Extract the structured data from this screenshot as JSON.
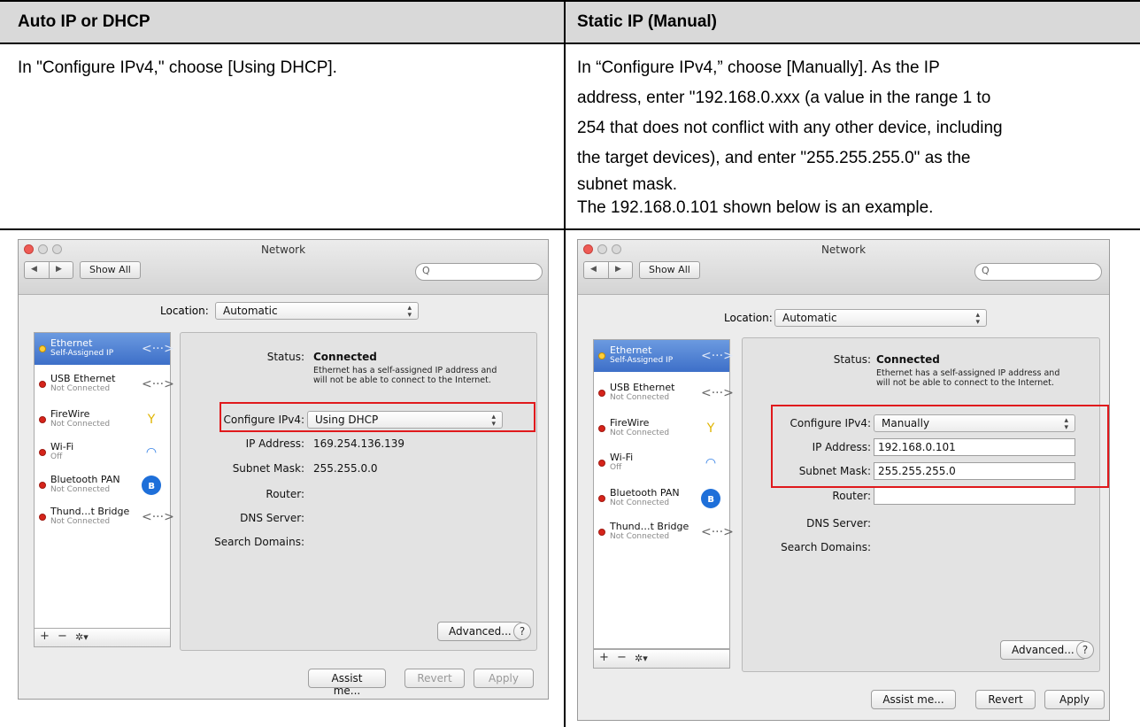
{
  "table": {
    "col1_header": "Auto IP or DHCP",
    "col2_header": "Static IP (Manual)",
    "col1_text": "In \"Configure IPv4,\" choose [Using DHCP].",
    "col2_lines": [
      "In “Configure IPv4,” choose [Manually]. As the IP",
      "address, enter \"192.168.0.xxx (a value in the range 1 to",
      "254 that does not conflict with any other device, including",
      "the target devices), and enter \"255.255.255.0\" as the",
      "subnet mask.",
      "The 192.168.0.101 shown below is an example."
    ]
  },
  "common": {
    "window_title": "Network",
    "show_all": "Show All",
    "back_icon": "◀",
    "fwd_icon": "▶",
    "search_icon": "Q",
    "location_label": "Location:",
    "location_value": "Automatic",
    "status_label": "Status:",
    "status_value": "Connected",
    "status_note_1": "Ethernet has a self-assigned IP address and",
    "status_note_2": "will not be able to connect to the Internet.",
    "configure_label": "Configure IPv4:",
    "ip_label": "IP Address:",
    "subnet_label": "Subnet Mask:",
    "router_label": "Router:",
    "dns_label": "DNS Server:",
    "search_domains_label": "Search Domains:",
    "advanced": "Advanced...",
    "help": "?",
    "assist": "Assist me...",
    "revert": "Revert",
    "apply": "Apply",
    "tool_add": "+",
    "tool_remove": "−",
    "tool_gear": "✲▾",
    "services": [
      {
        "name": "Ethernet",
        "status": "Self-Assigned IP",
        "icon": "ethernet-icon",
        "glyph": "<···>"
      },
      {
        "name": "USB Ethernet",
        "status": "Not Connected",
        "icon": "ethernet-icon",
        "glyph": "<···>"
      },
      {
        "name": "FireWire",
        "status": "Not Connected",
        "icon": "firewire-icon",
        "glyph": "Y"
      },
      {
        "name": "Wi-Fi",
        "status": "Off",
        "icon": "wifi-icon",
        "glyph": "◠"
      },
      {
        "name": "Bluetooth PAN",
        "status": "Not Connected",
        "icon": "bluetooth-icon",
        "glyph": "ʙ"
      },
      {
        "name": "Thund…t Bridge",
        "status": "Not Connected",
        "icon": "ethernet-icon",
        "glyph": "<···>"
      }
    ]
  },
  "dhcp": {
    "configure_value": "Using DHCP",
    "ip_value": "169.254.136.139",
    "subnet_value": "255.255.0.0"
  },
  "manual": {
    "configure_value": "Manually",
    "ip_value": "192.168.0.101",
    "subnet_value": "255.255.255.0",
    "router_value": ""
  }
}
